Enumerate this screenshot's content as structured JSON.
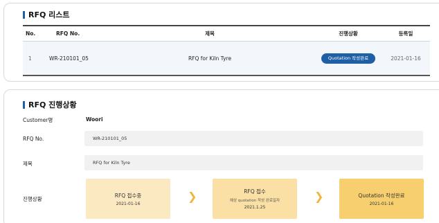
{
  "list_section": {
    "title": "RFQ 리스트",
    "columns": {
      "no": "No.",
      "rfq_no": "RFQ No.",
      "title": "제목",
      "status": "진행상황",
      "date": "등록일"
    },
    "rows": [
      {
        "no": "1",
        "rfq_no": "WR-210101_05",
        "title": "RFQ for Kiln Tyre",
        "status": "Quotation 작성완료",
        "date": "2021-01-16"
      }
    ]
  },
  "progress_section": {
    "title": "RFQ 진행상황",
    "customer_label": "Customer명",
    "customer_value": "Woori",
    "rfq_no_label": "RFQ No.",
    "rfq_no_value": "WR-210101_05",
    "subject_label": "제목",
    "subject_value": "RFQ for Kiln Tyre",
    "status_label": "진행상황",
    "steps": [
      {
        "title": "RFQ 접수중",
        "subtitle": "",
        "date": "2021-01-16"
      },
      {
        "title": "RFQ 접수",
        "subtitle": "예상 quotation 작성 완료일자",
        "date": "2021.1.25"
      },
      {
        "title": "Quotation 작성완료",
        "subtitle": "",
        "date": "2021-01-16"
      }
    ],
    "arrow_icon": "chevron-right-icon"
  },
  "colors": {
    "accent": "#1f5fa6",
    "step1": "#fbe9c2",
    "step2": "#fbe0a5",
    "step3": "#f8cf6f",
    "arrow": "#f2b43a"
  }
}
